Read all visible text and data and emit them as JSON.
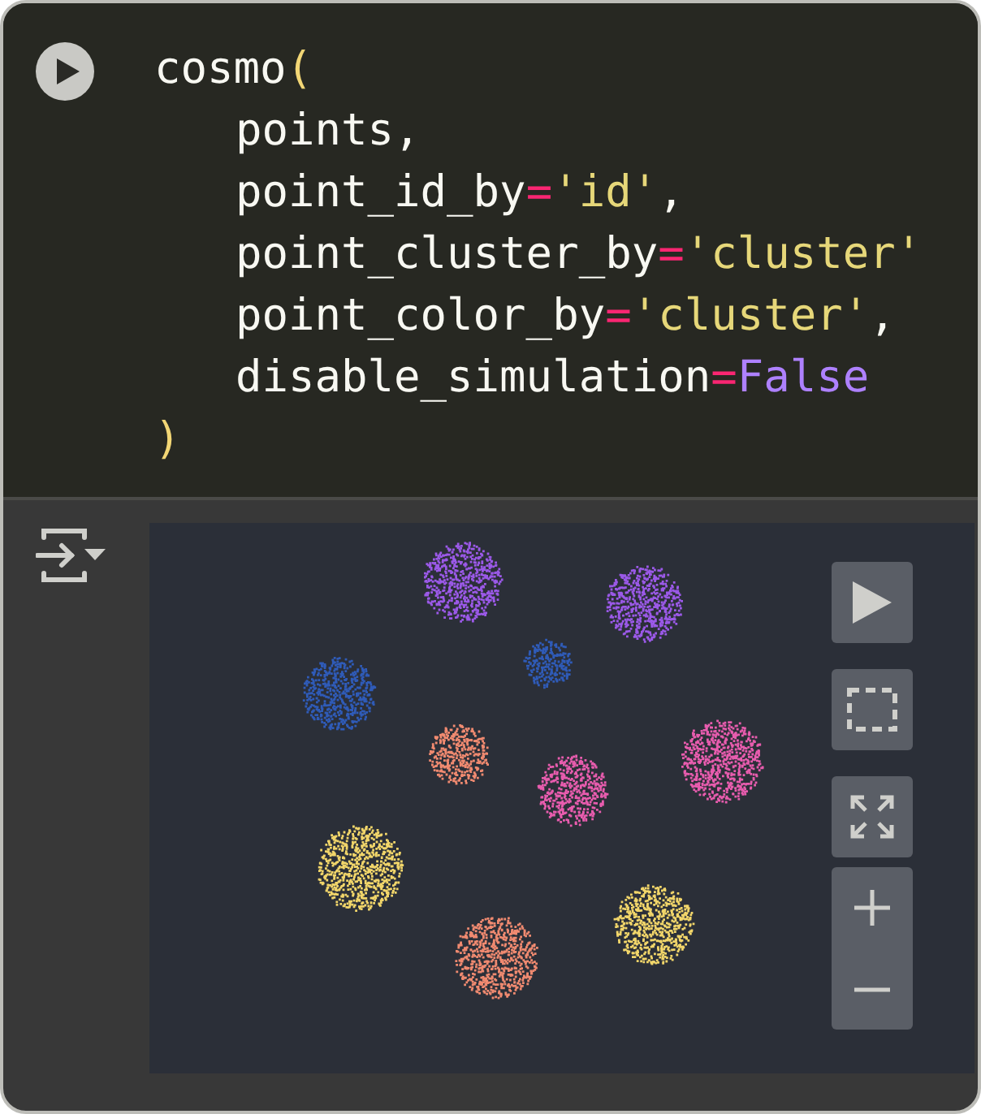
{
  "code_cell": {
    "lines": [
      {
        "indented": false,
        "tokens": [
          {
            "kind": "name",
            "text": "cosmo"
          },
          {
            "kind": "paren",
            "text": "("
          }
        ]
      },
      {
        "indented": true,
        "tokens": [
          {
            "kind": "name",
            "text": "points,"
          }
        ]
      },
      {
        "indented": true,
        "tokens": [
          {
            "kind": "name",
            "text": "point_id_by"
          },
          {
            "kind": "op",
            "text": "="
          },
          {
            "kind": "string",
            "text": "'id'"
          },
          {
            "kind": "name",
            "text": ","
          }
        ]
      },
      {
        "indented": true,
        "tokens": [
          {
            "kind": "name",
            "text": "point_cluster_by"
          },
          {
            "kind": "op",
            "text": "="
          },
          {
            "kind": "string",
            "text": "'cluster'"
          }
        ]
      },
      {
        "indented": true,
        "tokens": [
          {
            "kind": "name",
            "text": "point_color_by"
          },
          {
            "kind": "op",
            "text": "="
          },
          {
            "kind": "string",
            "text": "'cluster'"
          },
          {
            "kind": "name",
            "text": ","
          }
        ]
      },
      {
        "indented": true,
        "tokens": [
          {
            "kind": "name",
            "text": "disable_simulation"
          },
          {
            "kind": "op",
            "text": "="
          },
          {
            "kind": "keyword",
            "text": "False"
          }
        ]
      },
      {
        "indented": false,
        "tokens": [
          {
            "kind": "paren",
            "text": ")"
          }
        ]
      }
    ]
  },
  "graph": {
    "clusters": [
      {
        "color": "#9b59e8"
      },
      {
        "color": "#9b59e8"
      },
      {
        "color": "#2f5bb8"
      },
      {
        "color": "#2f5bb8"
      },
      {
        "color": "#f08a70"
      },
      {
        "color": "#e85cae"
      },
      {
        "color": "#e85cae"
      },
      {
        "color": "#f2d66a"
      },
      {
        "color": "#f08a70"
      },
      {
        "color": "#f2d66a"
      }
    ],
    "controls": [
      {
        "kind": "play"
      },
      {
        "kind": "select"
      },
      {
        "kind": "fit"
      },
      {
        "kind": "zoom"
      }
    ]
  }
}
